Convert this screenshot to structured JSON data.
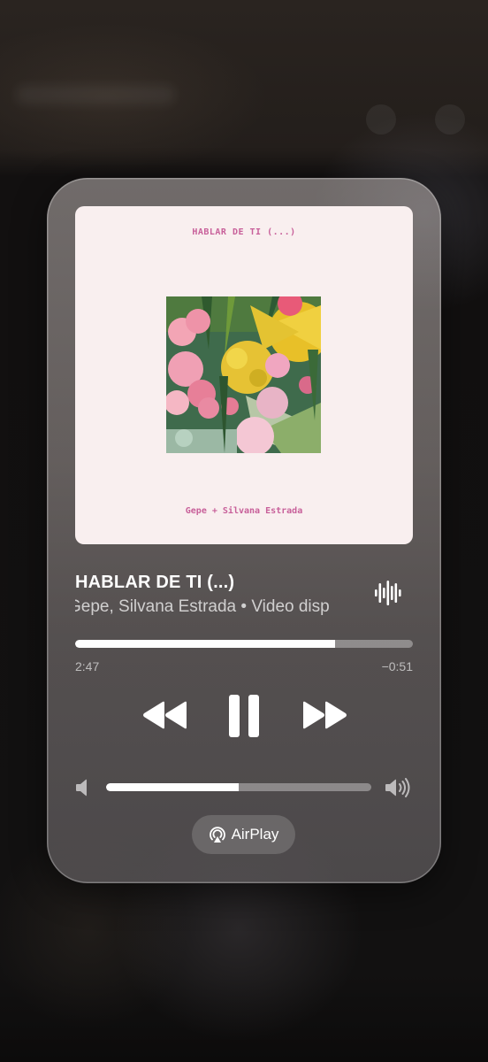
{
  "now_playing": {
    "artwork": {
      "title_text": "HABLAR DE TI  (...)",
      "credit_text": "Gepe + Silvana Estrada"
    },
    "title": "HABLAR DE TI (...)",
    "subtitle": "Gepe, Silvana Estrada • Video disp",
    "progress_fraction": 0.77,
    "elapsed": "2:47",
    "remaining": "−0:51",
    "volume_fraction": 0.5
  },
  "controls": {
    "rewind_icon": "backward-icon",
    "pause_icon": "pause-icon",
    "forward_icon": "forward-icon",
    "waveform_icon": "waveform-icon",
    "volume_low_icon": "speaker-low-icon",
    "volume_high_icon": "speaker-high-icon"
  },
  "airplay": {
    "label": "AirPlay",
    "icon": "airplay-icon"
  },
  "colors": {
    "accent_pink": "#c8609a",
    "artwork_bg": "#f9efef"
  }
}
